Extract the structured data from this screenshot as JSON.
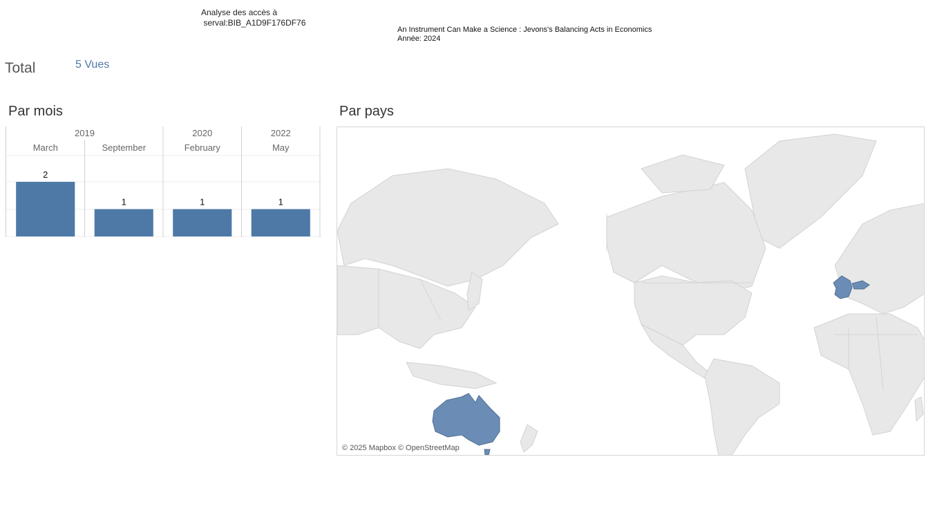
{
  "header": {
    "analysis_title": "Analyse des accès à\n serval:BIB_A1D9F176DF76",
    "work_title": "An Instrument Can Make a Science : Jevons's Balancing Acts in Economics",
    "work_year": "Année: 2024"
  },
  "summary": {
    "total_label": "Total",
    "total_value": "5 Vues"
  },
  "sections": {
    "by_month": "Par mois",
    "by_country": "Par pays"
  },
  "chart_data": {
    "type": "bar",
    "years": [
      {
        "label": "2019",
        "months": [
          "March",
          "September"
        ]
      },
      {
        "label": "2020",
        "months": [
          "February"
        ]
      },
      {
        "label": "2022",
        "months": [
          "May"
        ]
      }
    ],
    "categories": [
      "March",
      "September",
      "February",
      "May"
    ],
    "values": [
      2,
      1,
      1,
      1
    ],
    "data_labels": [
      "2",
      "1",
      "1",
      "1"
    ],
    "ylim": [
      0,
      2
    ],
    "grid": true,
    "color": "#4e79a7"
  },
  "map": {
    "highlighted_countries": [
      "Australia",
      "France",
      "Switzerland"
    ],
    "highlight_color": "#6b8db5",
    "land_color": "#e8e8e8",
    "attribution": "© 2025 Mapbox © OpenStreetMap"
  }
}
